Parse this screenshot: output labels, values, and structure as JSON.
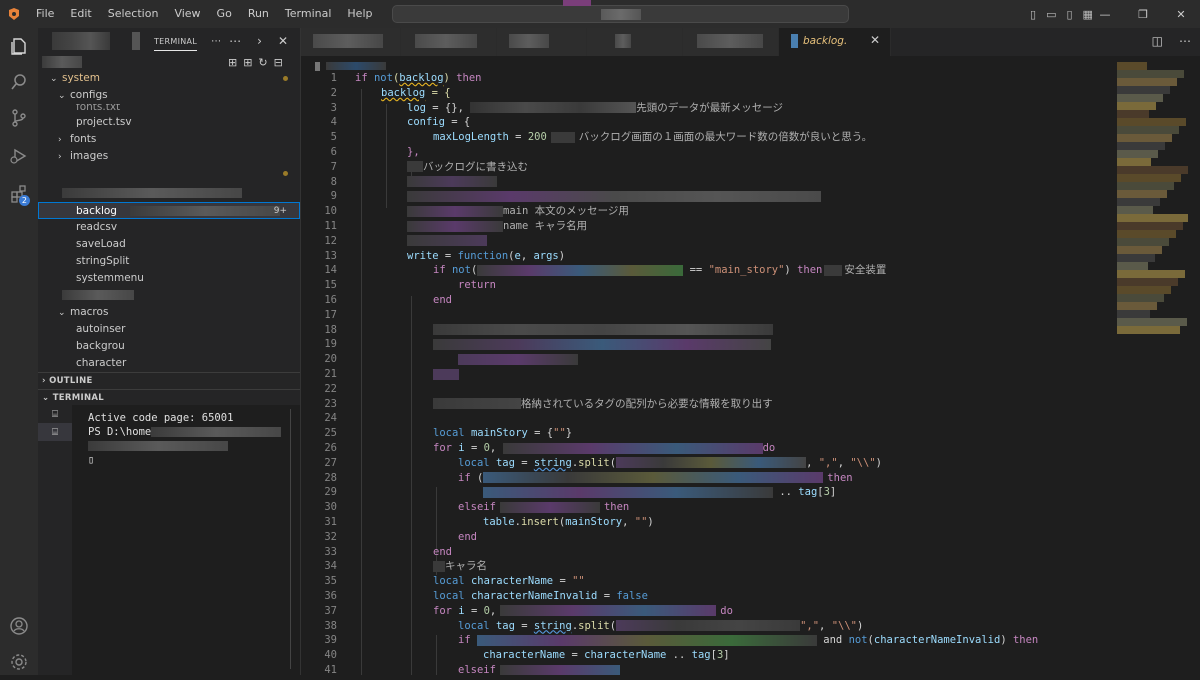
{
  "menu": [
    "File",
    "Edit",
    "Selection",
    "View",
    "Go",
    "Run",
    "Terminal",
    "Help"
  ],
  "sidebar": {
    "tab_label": "TERMINAL",
    "tree": [
      {
        "label": "system",
        "kind": "folder-open",
        "level": 0,
        "color": "#e2c08d",
        "dot": true
      },
      {
        "label": "configs",
        "kind": "folder-open",
        "level": 1
      },
      {
        "label": "fonts.txt",
        "kind": "file",
        "level": 2
      },
      {
        "label": "project.tsv",
        "kind": "file",
        "level": 2
      },
      {
        "label": "fonts",
        "kind": "folder",
        "level": 1
      },
      {
        "label": "images",
        "kind": "folder",
        "level": 1
      }
    ],
    "modules": [
      {
        "label": "backlog",
        "selected": true,
        "count": "9+"
      },
      {
        "label": "readcsv"
      },
      {
        "label": "saveLoad"
      },
      {
        "label": "stringSplit"
      },
      {
        "label": "systemmenu"
      }
    ],
    "macros_label": "macros",
    "macros": [
      "autoinser",
      "backgrou",
      "character"
    ],
    "outline_label": "OUTLINE",
    "terminal_label": "TERMINAL"
  },
  "terminal": {
    "line1": "Active code page: 65001",
    "line2": "PS D:\\home"
  },
  "editor": {
    "active_tab": "backlog.",
    "lines": [
      {
        "n": "1"
      },
      {
        "n": "2"
      },
      {
        "n": "3"
      },
      {
        "n": "4"
      },
      {
        "n": "5"
      },
      {
        "n": "6"
      },
      {
        "n": "7"
      },
      {
        "n": "8"
      },
      {
        "n": "9"
      },
      {
        "n": "10"
      },
      {
        "n": "11"
      },
      {
        "n": "12"
      },
      {
        "n": "13"
      },
      {
        "n": "14"
      },
      {
        "n": "15"
      },
      {
        "n": "16"
      },
      {
        "n": "17"
      },
      {
        "n": "18"
      },
      {
        "n": "19"
      },
      {
        "n": "20"
      },
      {
        "n": "21"
      },
      {
        "n": "22"
      },
      {
        "n": "23"
      },
      {
        "n": "24"
      },
      {
        "n": "25"
      },
      {
        "n": "26"
      },
      {
        "n": "27"
      },
      {
        "n": "28"
      },
      {
        "n": "29"
      },
      {
        "n": "30"
      },
      {
        "n": "31"
      },
      {
        "n": "32"
      },
      {
        "n": "33"
      },
      {
        "n": "34"
      },
      {
        "n": "35"
      },
      {
        "n": "36"
      },
      {
        "n": "37"
      },
      {
        "n": "38"
      },
      {
        "n": "39"
      },
      {
        "n": "40"
      },
      {
        "n": "41"
      }
    ],
    "code": {
      "l1a": "if ",
      "l1b": "not",
      "l1c": "(",
      "l1d": "backlog",
      "l1e": ") ",
      "l1f": "then",
      "l2a": "backlog",
      " l2b": " = {",
      "l3a": "log",
      " l3b": " = {}, ",
      "l3c": "先頭のデータが最新メッセージ",
      "l4a": "config",
      "l4b": " = {",
      "l5a": "maxLogLength",
      "l5b": " = ",
      "l5c": "200",
      "l5d": "バックログ画面の１画面の最大ワード数の倍数が良いと思う。",
      "l6": "},",
      "l7": "バックログに書き込む",
      "l10": "main 本文のメッセージ用",
      "l11": "name キャラ名用",
      "l13a": "write",
      " l13b": " = ",
      "l13c": "function",
      "l13d": "(",
      "l13e": "e",
      ", l13f": ", ",
      "l13g": "args",
      "l13h": ")",
      "l14a": "if ",
      "l14b": "not",
      "l14c": "(",
      "l14d": " == ",
      "l14e": "\"main_story\"",
      "l14f": ") ",
      "l14g": "then",
      "l14h": "安全装置",
      "l15": "return",
      "l16": "end",
      "l23": "格納されているタグの配列から必要な情報を取り出す",
      "l25a": "local ",
      "l25b": "mainStory",
      "l25c": " = {",
      "l25d": "\"\"",
      "l25e": "}",
      "l26a": "for ",
      "l26b": "i",
      " l26c": " = ",
      "l26d": "0",
      ", l26e": ",",
      "l26f": "do",
      "l27a": "local ",
      "l27b": "tag",
      "l27c": " = ",
      "l27d": "string",
      "l27e": ".",
      "l27f": "split",
      "l27g": "(",
      "l27h": ", ",
      "l27i": "\",\"",
      ", l27j": ", ",
      "l27k": "\"\\\\\"",
      "l27l": ")",
      "l28a": "if ",
      "l28b": "(",
      "l28c": "then",
      "l29a": " .. ",
      "l29b": "tag",
      "l29c": "[",
      "l29d": "3",
      "l29e": "]",
      "l30a": "elseif",
      "l30b": "then",
      "l31a": "table",
      "l31b": ".",
      "l31c": "insert",
      "l31d": "(",
      "l31e": "mainStory",
      ", l31f": ", ",
      "l31g": "\"\"",
      "l31h": ")",
      "l32": "end",
      "l33": "end",
      "l34": "キャラ名",
      "l35a": "local ",
      "l35b": "characterName",
      "l35c": " = ",
      "l35d": "\"\"",
      "l36a": "local ",
      "l36b": "characterNameInvalid",
      "l36c": " = ",
      "l36d": "false",
      "l37a": "for ",
      "l37b": "i",
      "l37c": " = ",
      "l37d": "0",
      "l37e": ",",
      "l37f": "do",
      "l38a": "local ",
      "l38b": "tag",
      "l38c": " = ",
      "l38d": "string",
      "l38e": ".",
      "l38f": "split",
      "l38g": "(",
      "l38h": "\",\"",
      "l38i": ", ",
      "l38j": "\"\\\\\"",
      "l38k": ")",
      "l39a": "if ",
      "l39b": " and ",
      "l39c": "not",
      "l39d": "(",
      "l39e": "characterNameInvalid",
      "l39f": ") ",
      "l39g": "then",
      "l40a": "characterName",
      "l40b": " = ",
      "l40c": "characterName",
      "l40d": " .. ",
      "l40e": "tag",
      "l40f": "[",
      "l40g": "3",
      "l40h": "]",
      "l41": "elseif"
    }
  },
  "colors": {
    "accent": "#0078d4",
    "folder": "#e2c08d",
    "keyword": "#c586c0",
    "variable": "#9cdcfe",
    "string": "#ce9178",
    "function": "#dcdcaa",
    "number": "#b5cea8"
  },
  "icons": [
    "explorer-icon",
    "search-icon",
    "source-control-icon",
    "run-debug-icon",
    "extensions-icon",
    "account-icon",
    "settings-gear-icon"
  ]
}
